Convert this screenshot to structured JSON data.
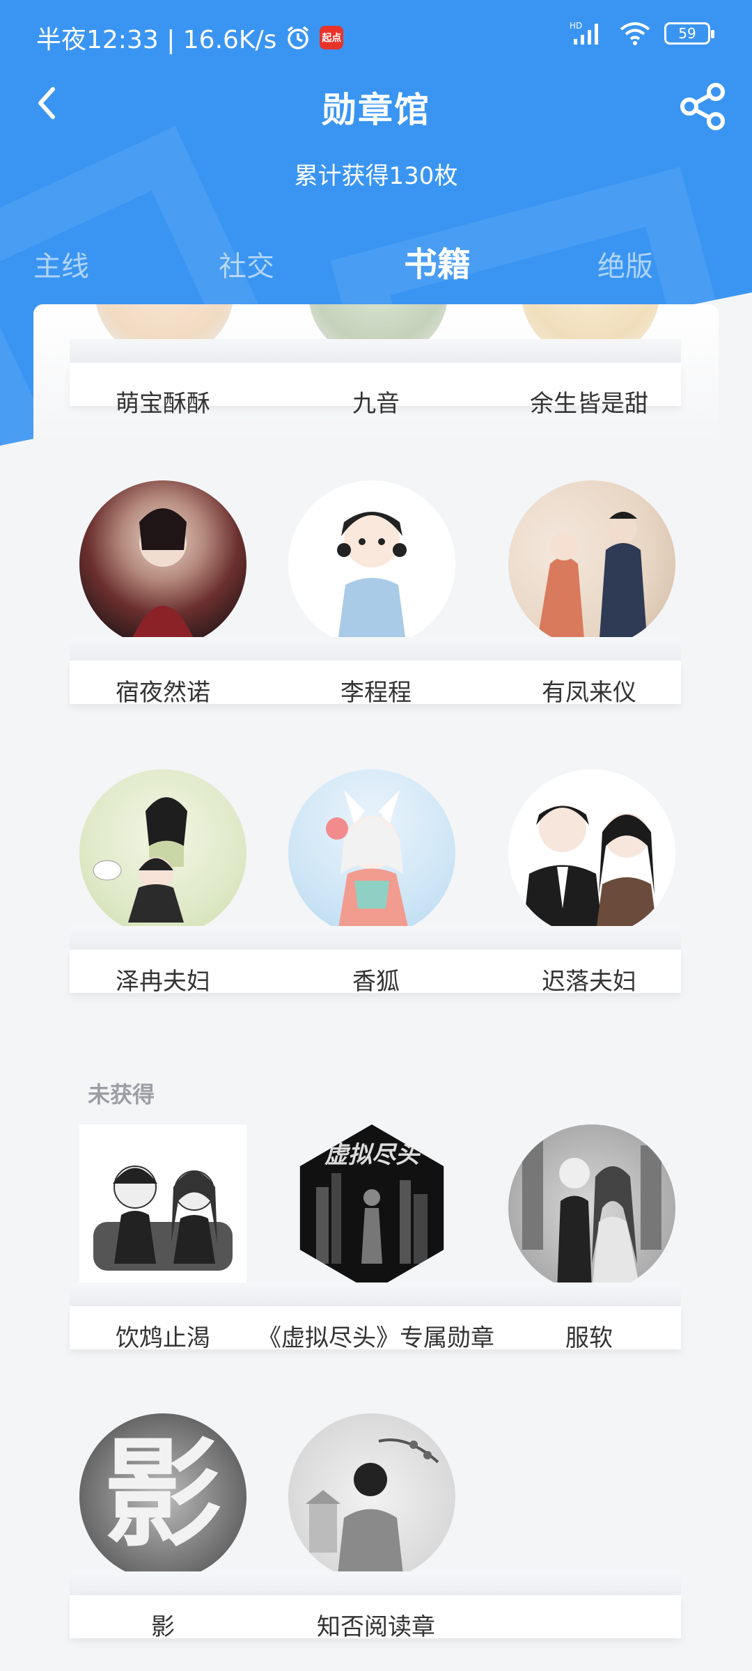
{
  "status": {
    "time": "半夜12:33 | 16.6K/s",
    "app_badge": "起点",
    "hd": "HD",
    "battery": "59"
  },
  "nav": {
    "title": "勋章馆",
    "subtitle": "累计获得130枚"
  },
  "tabs": [
    {
      "label": "主线",
      "active": false
    },
    {
      "label": "社交",
      "active": false
    },
    {
      "label": "书籍",
      "active": true
    },
    {
      "label": "绝版",
      "active": false
    }
  ],
  "obtained_badges": [
    {
      "label": "萌宝酥酥"
    },
    {
      "label": "九音"
    },
    {
      "label": "余生皆是甜"
    },
    {
      "label": "宿夜然诺"
    },
    {
      "label": "李程程"
    },
    {
      "label": "有凤来仪"
    },
    {
      "label": "泽冉夫妇"
    },
    {
      "label": "香狐"
    },
    {
      "label": "迟落夫妇"
    }
  ],
  "unobtained_section": {
    "title": "未获得",
    "badges": [
      {
        "label": "饮鸩止渴"
      },
      {
        "label": "《虚拟尽头》专属勋章"
      },
      {
        "label": "服软"
      },
      {
        "label": "影"
      },
      {
        "label": "知否阅读章"
      }
    ]
  },
  "colors": {
    "primary": "#3a95f2",
    "background": "#f4f5f7"
  }
}
